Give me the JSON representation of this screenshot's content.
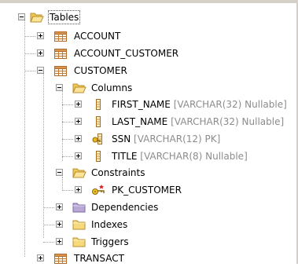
{
  "tree": {
    "root": {
      "label": "Tables"
    },
    "tables": [
      {
        "label": "ACCOUNT"
      },
      {
        "label": "ACCOUNT_CUSTOMER"
      },
      {
        "label": "CUSTOMER"
      },
      {
        "label": "TRANSACT"
      }
    ],
    "customer": {
      "columns_folder": "Columns",
      "columns": [
        {
          "name": "FIRST_NAME",
          "detail": "[VARCHAR(32) Nullable]"
        },
        {
          "name": "LAST_NAME",
          "detail": "[VARCHAR(32) Nullable]"
        },
        {
          "name": "SSN",
          "detail": "[VARCHAR(12) PK]"
        },
        {
          "name": "TITLE",
          "detail": "[VARCHAR(8) Nullable]"
        }
      ],
      "constraints_folder": "Constraints",
      "constraint": {
        "name": "PK_CUSTOMER"
      },
      "dependencies": "Dependencies",
      "indexes": "Indexes",
      "triggers": "Triggers"
    }
  },
  "colors": {
    "folder": "#f5d97a",
    "folder_edge": "#c9a232",
    "dependencies_folder": "#b9a8d6",
    "table_grid": "#c07a36",
    "detail_text": "#8c8c8c"
  },
  "icons": {
    "folder": "folder-icon",
    "table": "table-icon",
    "column": "column-icon",
    "key_column": "primary-key-column-icon",
    "constraint": "key-constraint-icon",
    "dependencies": "dependencies-folder-icon"
  }
}
